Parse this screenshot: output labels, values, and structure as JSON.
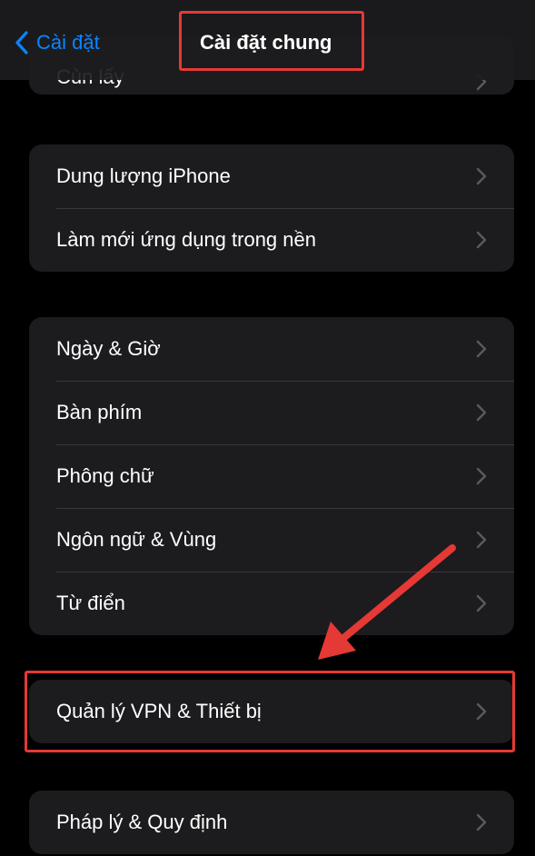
{
  "nav": {
    "back_label": "Cài đặt",
    "title": "Cài đặt chung"
  },
  "groups": [
    {
      "rows": [
        {
          "label": "Cùn lấy"
        }
      ]
    },
    {
      "rows": [
        {
          "label": "Dung lượng iPhone"
        },
        {
          "label": "Làm mới ứng dụng trong nền"
        }
      ]
    },
    {
      "rows": [
        {
          "label": "Ngày & Giờ"
        },
        {
          "label": "Bàn phím"
        },
        {
          "label": "Phông chữ"
        },
        {
          "label": "Ngôn ngữ & Vùng"
        },
        {
          "label": "Từ điển"
        }
      ]
    },
    {
      "rows": [
        {
          "label": "Quản lý VPN & Thiết bị"
        }
      ]
    },
    {
      "rows": [
        {
          "label": "Pháp lý & Quy định"
        }
      ]
    }
  ],
  "colors": {
    "accent": "#0a84ff",
    "annotation": "#e53935",
    "cell_background": "#1c1c1e"
  }
}
